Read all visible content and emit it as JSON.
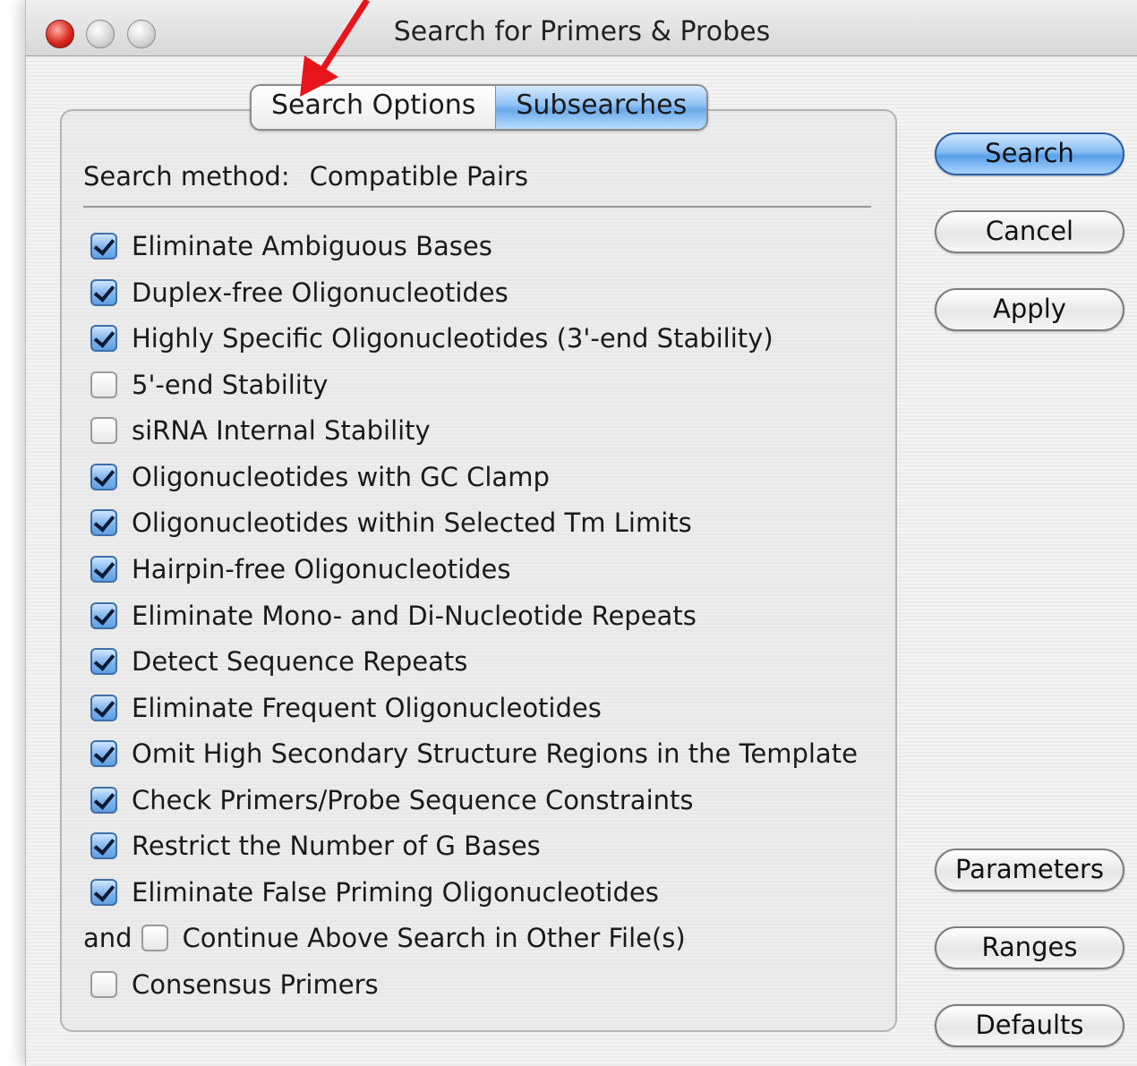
{
  "window": {
    "title": "Search for Primers & Probes"
  },
  "tabs": [
    {
      "label": "Search Options",
      "selected": false
    },
    {
      "label": "Subsearches",
      "selected": true
    }
  ],
  "search_method": {
    "label": "Search method:",
    "value": "Compatible Pairs"
  },
  "options": [
    {
      "label": "Eliminate Ambiguous Bases",
      "checked": true
    },
    {
      "label": "Duplex-free Oligonucleotides",
      "checked": true
    },
    {
      "label": "Highly Specific Oligonucleotides (3'-end Stability)",
      "checked": true
    },
    {
      "label": "5'-end Stability",
      "checked": false
    },
    {
      "label": "siRNA Internal Stability",
      "checked": false
    },
    {
      "label": "Oligonucleotides with GC Clamp",
      "checked": true
    },
    {
      "label": "Oligonucleotides within Selected Tm Limits",
      "checked": true
    },
    {
      "label": "Hairpin-free Oligonucleotides",
      "checked": true
    },
    {
      "label": "Eliminate Mono- and Di-Nucleotide Repeats",
      "checked": true
    },
    {
      "label": "Detect Sequence Repeats",
      "checked": true
    },
    {
      "label": "Eliminate Frequent Oligonucleotides",
      "checked": true
    },
    {
      "label": "Omit High Secondary Structure Regions in the Template",
      "checked": true
    },
    {
      "label": "Check Primers/Probe Sequence Constraints",
      "checked": true
    },
    {
      "label": "Restrict the Number of G Bases",
      "checked": true
    },
    {
      "label": "Eliminate False Priming Oligonucleotides",
      "checked": true
    }
  ],
  "continue_search": {
    "prefix": "and",
    "label": "Continue Above Search in Other File(s)",
    "checked": false
  },
  "consensus": {
    "label": "Consensus Primers",
    "checked": false
  },
  "buttons": {
    "search": "Search",
    "cancel": "Cancel",
    "apply": "Apply",
    "parameters": "Parameters",
    "ranges": "Ranges",
    "defaults": "Defaults"
  },
  "colors": {
    "accent": "#6aa9ea",
    "annotation_arrow": "#e8141c"
  }
}
